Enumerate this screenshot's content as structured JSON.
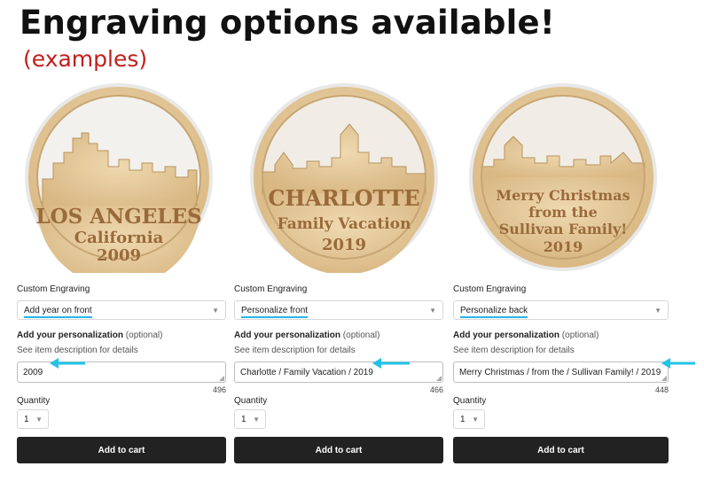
{
  "header": {
    "title": "Engraving options available!",
    "subtitle": "(examples)"
  },
  "form_labels": {
    "custom_engraving": "Custom Engraving",
    "add_personalization": "Add your personalization",
    "optional": "(optional)",
    "see_details": "See item description for details",
    "quantity": "Quantity",
    "add_to_cart": "Add to cart"
  },
  "products": [
    {
      "ornament": {
        "line1": "LOS ANGELES",
        "line2": "California",
        "line3": "2009"
      },
      "engraving_option": "Add year on front",
      "personalization_value": "2009",
      "char_counter": "496",
      "quantity": "1"
    },
    {
      "ornament": {
        "line1": "CHARLOTTE",
        "line2": "Family Vacation",
        "line3": "2019"
      },
      "engraving_option": "Personalize front",
      "personalization_value": "Charlotte / Family Vacation / 2019",
      "char_counter": "466",
      "quantity": "1"
    },
    {
      "ornament": {
        "line1": "Merry Christmas",
        "line2": "from the",
        "line3": "Sullivan Family!",
        "line4": "2019"
      },
      "engraving_option": "Personalize back",
      "personalization_value": "Merry Christmas / from the / Sullivan Family! / 2019",
      "char_counter": "448",
      "quantity": "1"
    }
  ],
  "colors": {
    "wood": "#e3c79a",
    "engraved_text": "#9a6a3a",
    "highlight_underline": "#28b6e6",
    "subtitle_red": "#c0201c",
    "button_bg": "#222222"
  }
}
